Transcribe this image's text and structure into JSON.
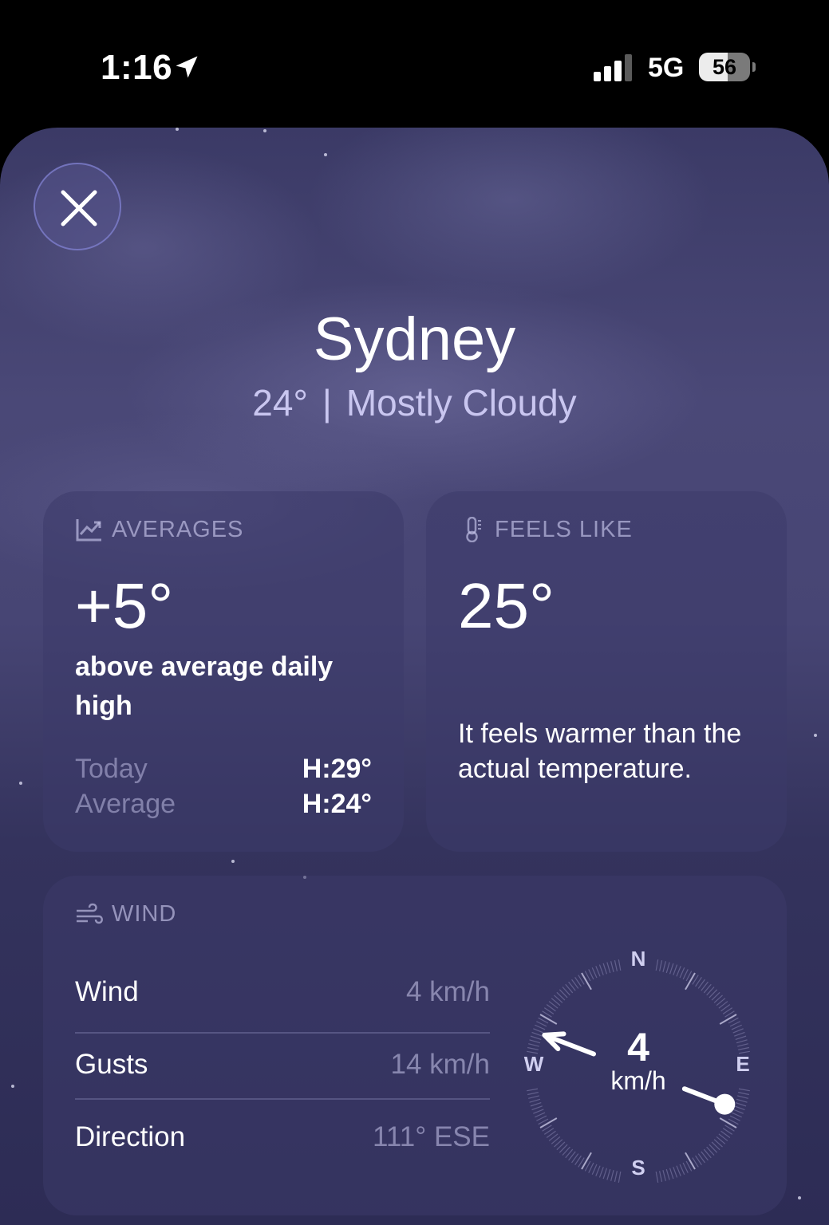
{
  "status_bar": {
    "time": "1:16",
    "network": "5G",
    "battery": "56"
  },
  "city": "Sydney",
  "current": {
    "temp": "24°",
    "separator": "|",
    "condition": "Mostly Cloudy"
  },
  "averages": {
    "header": "AVERAGES",
    "value": "+5°",
    "description": "above average daily high",
    "rows": [
      {
        "label": "Today",
        "value": "H:29°"
      },
      {
        "label": "Average",
        "value": "H:24°"
      }
    ]
  },
  "feels_like": {
    "header": "FEELS LIKE",
    "value": "25°",
    "description": "It feels warmer than the actual temperature."
  },
  "wind": {
    "header": "WIND",
    "rows": [
      {
        "label": "Wind",
        "value": "4 km/h"
      },
      {
        "label": "Gusts",
        "value": "14 km/h"
      },
      {
        "label": "Direction",
        "value": "111° ESE"
      }
    ],
    "compass": {
      "n": "N",
      "e": "E",
      "s": "S",
      "w": "W",
      "speed": "4",
      "unit": "km/h",
      "direction_deg": 111
    }
  },
  "icons": [
    "location-arrow-icon",
    "signal-icon",
    "battery-icon",
    "close-icon",
    "chart-icon",
    "thermometer-icon",
    "wind-icon"
  ]
}
